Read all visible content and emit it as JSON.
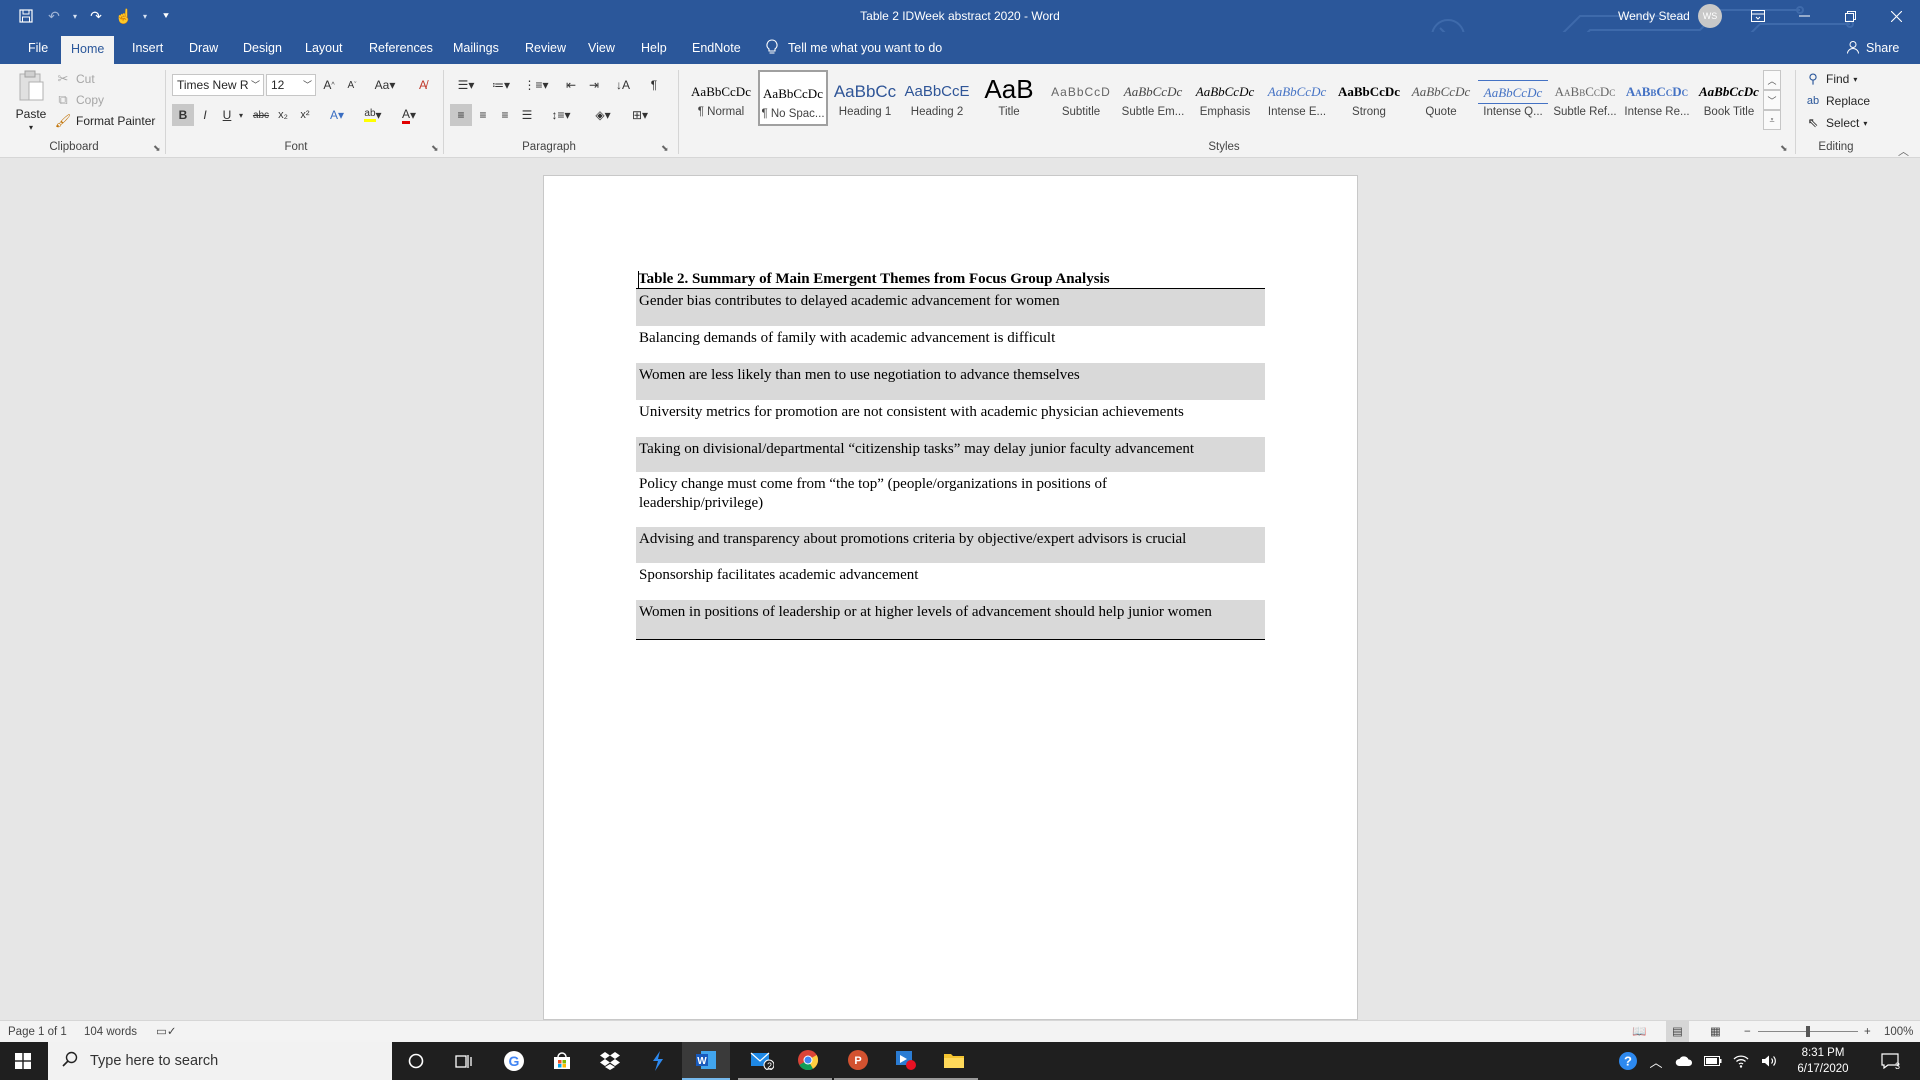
{
  "window": {
    "title": "Table 2 IDWeek abstract 2020  -  Word",
    "user_name": "Wendy Stead",
    "user_initials": "WS"
  },
  "ribbon_tabs": [
    "File",
    "Home",
    "Insert",
    "Draw",
    "Design",
    "Layout",
    "References",
    "Mailings",
    "Review",
    "View",
    "Help",
    "EndNote"
  ],
  "active_tab": "Home",
  "tell_me": "Tell me what you want to do",
  "share": "Share",
  "clipboard": {
    "paste": "Paste",
    "cut": "Cut",
    "copy": "Copy",
    "format_painter": "Format Painter",
    "group_label": "Clipboard"
  },
  "font": {
    "name": "Times New R",
    "size": "12",
    "group_label": "Font"
  },
  "paragraph": {
    "group_label": "Paragraph"
  },
  "styles": {
    "group_label": "Styles",
    "items": [
      {
        "sample": "AaBbCcDc",
        "label": "¶ Normal"
      },
      {
        "sample": "AaBbCcDc",
        "label": "¶ No Spac..."
      },
      {
        "sample": "AaBbCc",
        "label": "Heading 1"
      },
      {
        "sample": "AaBbCcE",
        "label": "Heading 2"
      },
      {
        "sample": "AaB",
        "label": "Title"
      },
      {
        "sample": "AaBbCcD",
        "label": "Subtitle"
      },
      {
        "sample": "AaBbCcDc",
        "label": "Subtle Em..."
      },
      {
        "sample": "AaBbCcDc",
        "label": "Emphasis"
      },
      {
        "sample": "AaBbCcDc",
        "label": "Intense E..."
      },
      {
        "sample": "AaBbCcDc",
        "label": "Strong"
      },
      {
        "sample": "AaBbCcDc",
        "label": "Quote"
      },
      {
        "sample": "AaBbCcDc",
        "label": "Intense Q..."
      },
      {
        "sample": "AaBbCcDc",
        "label": "Subtle Ref..."
      },
      {
        "sample": "AaBbCcDc",
        "label": "Intense Re..."
      },
      {
        "sample": "AaBbCcDc",
        "label": "Book Title"
      }
    ]
  },
  "editing": {
    "find": "Find",
    "replace": "Replace",
    "select": "Select",
    "group_label": "Editing"
  },
  "document": {
    "table_title": "Table 2. Summary of Main Emergent Themes from Focus Group Analysis",
    "rows": [
      "Gender bias contributes to delayed academic advancement for women",
      "Balancing demands of family with academic advancement is difficult",
      "Women are less likely than men to use negotiation to advance themselves",
      "University metrics for promotion are not consistent with academic physician achievements",
      "Taking on divisional/departmental “citizenship tasks” may delay junior faculty advancement",
      "Policy change must come from “the top” (people/organizations in positions of leadership/privilege)",
      "Advising and transparency about promotions criteria by objective/expert advisors is crucial",
      "Sponsorship facilitates academic advancement",
      "Women in positions of leadership or at higher levels of advancement should help junior women"
    ]
  },
  "status_bar": {
    "page": "Page 1 of 1",
    "words": "104 words",
    "zoom": "100%"
  },
  "taskbar": {
    "search_placeholder": "Type here to search",
    "mail_badge": "2",
    "time": "8:31 PM",
    "date": "6/17/2020",
    "notification_count": "3"
  },
  "colors": {
    "word_blue": "#2b579a",
    "ribbon_bg": "#f3f3f3",
    "row_shade": "#d9d9d9"
  }
}
